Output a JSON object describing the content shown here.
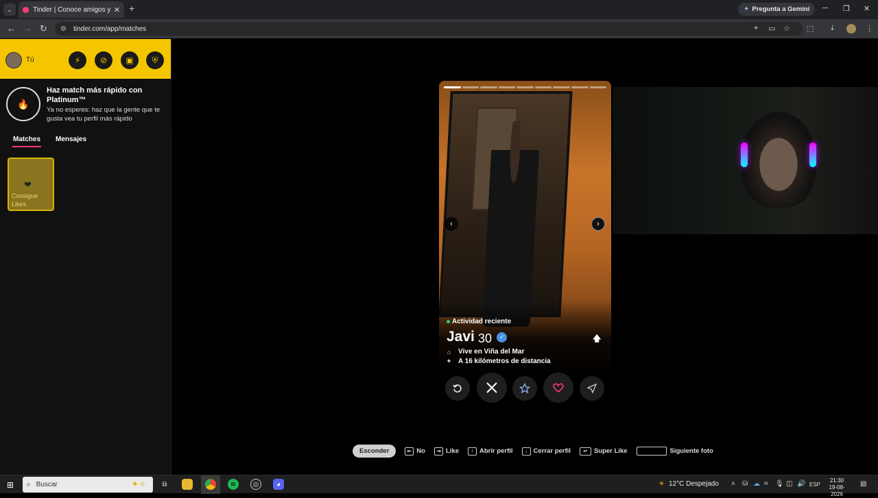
{
  "browser": {
    "tab_title": "Tinder | Conoce amigos y gente",
    "url": "tinder.com/app/matches",
    "gemini_label": "Pregunta a Gemini"
  },
  "sidebar": {
    "user_label": "Tú",
    "promo_title": "Haz match más rápido con Platinum™",
    "promo_desc": "Ya no esperes: haz que la gente que te gusta vea tu perfil más rápido",
    "tabs": [
      "Matches",
      "Mensajes"
    ],
    "active_tab": "Matches",
    "likes_card_label": "Consigue Likes"
  },
  "profile": {
    "activity": "Actividad reciente",
    "name": "Javi",
    "age": "30",
    "verified": true,
    "lives_in": "Vive en Viña del Mar",
    "distance": "A 16 kilómetros de distancia",
    "photo_count": 9,
    "current_photo": 1
  },
  "shortcuts": {
    "hide_label": "Esconder",
    "items": [
      "No",
      "Like",
      "Abrir perfil",
      "Cerrar perfil",
      "Super Like",
      "Siguiente foto"
    ]
  },
  "taskbar": {
    "search_placeholder": "Buscar",
    "weather": "12°C  Despejado",
    "lang": "ESP",
    "time": "21:30",
    "date": "19-08-2026"
  },
  "colors": {
    "tinder_pink": "#fe3c72",
    "gold": "#f5c600",
    "like_red": "#fe3c72"
  }
}
